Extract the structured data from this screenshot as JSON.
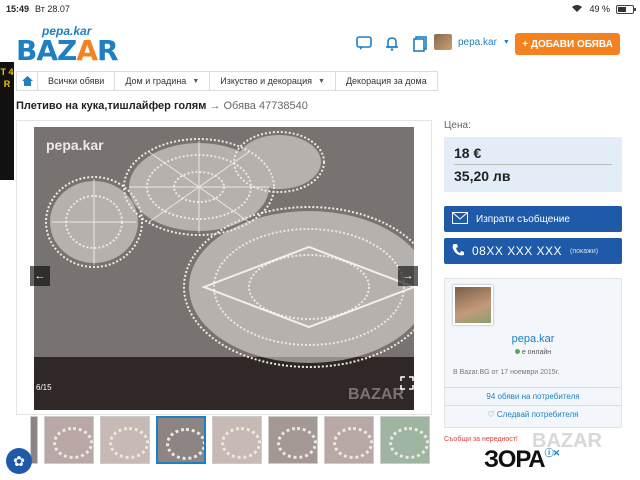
{
  "status": {
    "time": "15:49",
    "date": "Вт 28.07",
    "battery": "49 %"
  },
  "header": {
    "logo_small": "pepa.kar",
    "logo_big_1": "BAZ",
    "logo_big_a": "A",
    "logo_big_2": "R",
    "username": "pepa.kar",
    "add_button": "+ ДОБАВИ ОБЯВА"
  },
  "breadcrumb": {
    "items": [
      {
        "label": "Всички обяви"
      },
      {
        "label": "Дом и градина"
      },
      {
        "label": "Изкуство и декорация"
      },
      {
        "label": "Декорация за дома"
      }
    ]
  },
  "listing": {
    "title": "Плетиво на кука,тишлайфер голям",
    "arrow": "→",
    "listing_id": "Обява 47738540"
  },
  "gallery": {
    "watermark": "pepa.kar",
    "watermark_site": "BAZAR",
    "counter": "6/15",
    "prev": "←",
    "next": "→"
  },
  "price": {
    "label": "Цена:",
    "eur": "18 €",
    "bgn": "35,20 лв"
  },
  "actions": {
    "message": "Изпрати съобщение",
    "phone": "08XX XXX XXX",
    "phone_show": "(покажи)"
  },
  "seller": {
    "name": "pepa.kar",
    "status": "е онлайн",
    "since": "В Bazar.BG от 17 ноември 2015г.",
    "ads_count": "94 обяви на потребителя",
    "follow": "Следвай потребителя"
  },
  "report": "Съобщи за нередност!",
  "ad": {
    "brand": "ЗОРА",
    "mark": "ⓘ✕"
  },
  "left_ad": {
    "text": "T 4 R"
  },
  "colors": {
    "accent": "#1e7fc4",
    "orange": "#f58220",
    "button": "#1e5aa8"
  }
}
